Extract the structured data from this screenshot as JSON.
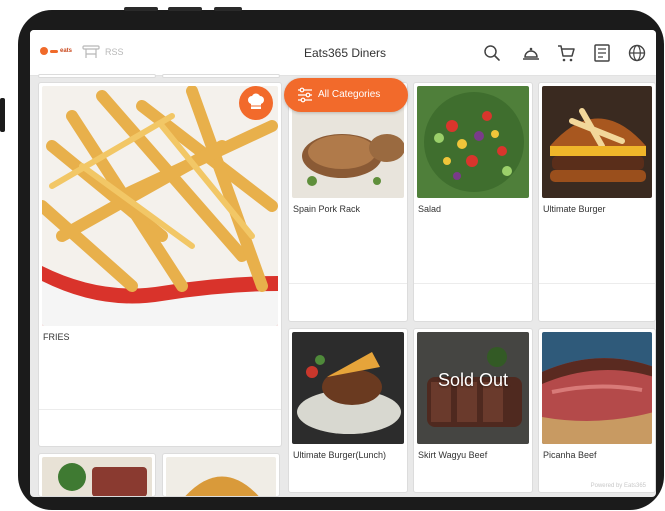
{
  "header": {
    "logo_text": "eats",
    "table_label": "RSS",
    "store_name": "Eats365 Diners",
    "icons": [
      "search-icon",
      "service-bell-icon",
      "cart-icon",
      "order-list-icon",
      "globe-icon"
    ]
  },
  "category_button": {
    "label": "All Categories",
    "icon": "filter-sliders-icon"
  },
  "menu": {
    "items": [
      {
        "name": "FRIES",
        "image": "fries"
      },
      {
        "name": "Spain Pork Rack",
        "image": "pork"
      },
      {
        "name": "Salad",
        "image": "salad"
      },
      {
        "name": "Ultimate Burger",
        "image": "burger"
      },
      {
        "name": "Ultimate Burger(Lunch)",
        "image": "burger2"
      },
      {
        "name": "Skirt Wagyu Beef",
        "image": "wagyu",
        "badge": "Sold Out"
      },
      {
        "name": "Picanha Beef",
        "image": "picanha"
      }
    ]
  },
  "footer": {
    "powered_by": "Powered by Eats365"
  },
  "colors": {
    "accent": "#f26a2b",
    "background": "#e9e9e9"
  }
}
